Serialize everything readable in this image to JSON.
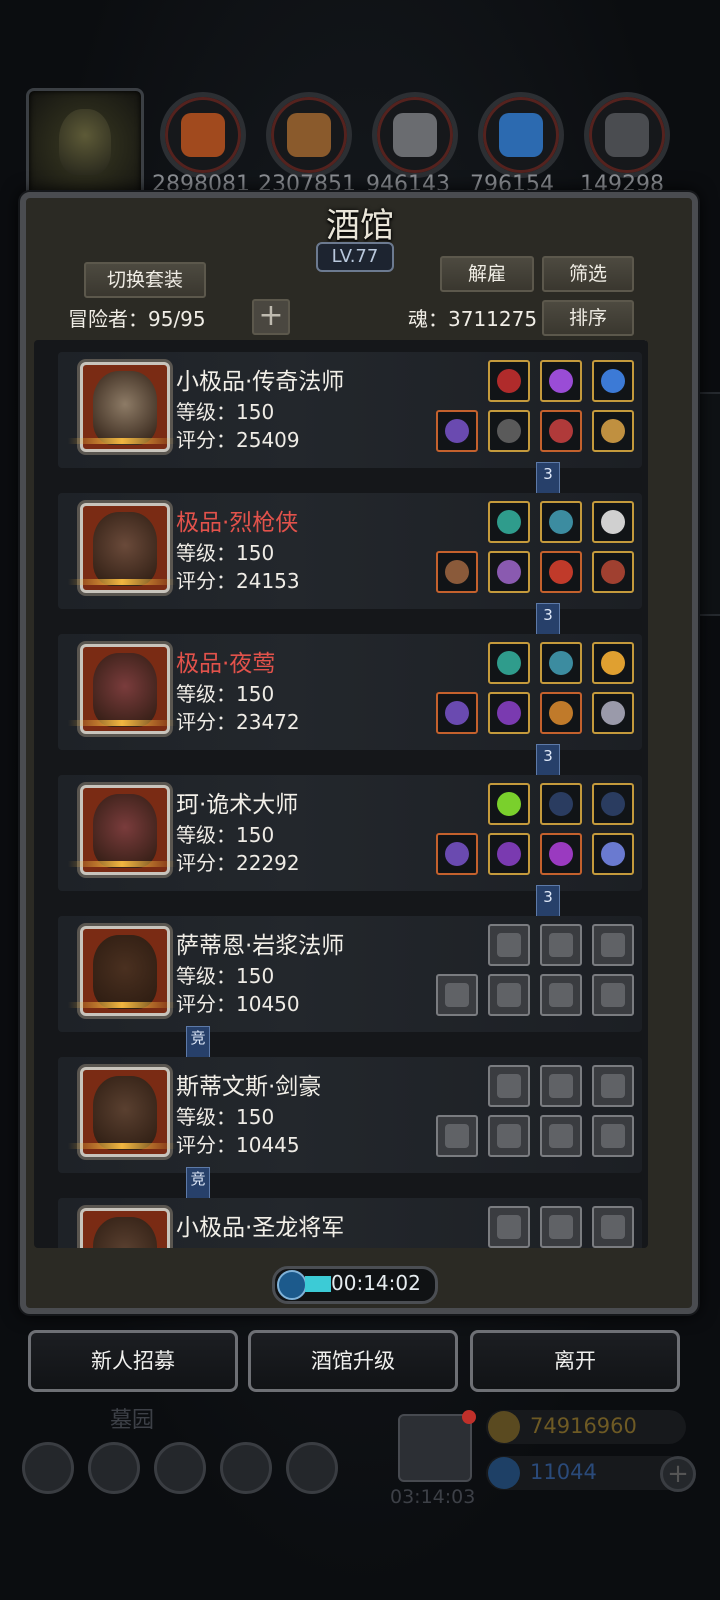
{
  "top": {
    "resources": [
      {
        "value": "2898081",
        "icon": "meat-icon",
        "color": "#a14a1e"
      },
      {
        "value": "2307851",
        "icon": "wood-icon",
        "color": "#8a5a2c"
      },
      {
        "value": "946143",
        "icon": "stone-icon",
        "color": "#6a6c70"
      },
      {
        "value": "796154",
        "icon": "crystal-icon",
        "color": "#2c6ab0"
      },
      {
        "value": "149298",
        "icon": "iron-icon",
        "color": "#4a4c50"
      }
    ]
  },
  "tavern": {
    "title": "酒馆",
    "level": "LV.77",
    "switch_outfit": "切换套装",
    "dismiss": "解雇",
    "filter": "筛选",
    "sort": "排序",
    "adventurer_label": "冒险者：95/95",
    "soul_label": "魂：3711275",
    "plus": "+"
  },
  "heroes": [
    {
      "name": "小极品·传奇法师",
      "rare": false,
      "level": "等级：150",
      "score": "评分：25409",
      "tag": "3",
      "face": "#8d7b66"
    },
    {
      "name": "极品·烈枪侠",
      "rare": true,
      "level": "等级：150",
      "score": "评分：24153",
      "tag": "3",
      "face": "#6a4a3a"
    },
    {
      "name": "极品·夜莺",
      "rare": true,
      "level": "等级：150",
      "score": "评分：23472",
      "tag": "3",
      "face": "#7a3c3c"
    },
    {
      "name": "珂·诡术大师",
      "rare": false,
      "level": "等级：150",
      "score": "评分：22292",
      "tag": "3",
      "face": "#7a3c3c"
    },
    {
      "name": "萨蒂恩·岩浆法师",
      "rare": false,
      "level": "等级：150",
      "score": "评分：10450",
      "tag": "竞",
      "face": "#4a3020"
    },
    {
      "name": "斯蒂文斯·剑豪",
      "rare": false,
      "level": "等级：150",
      "score": "评分：10445",
      "tag": "竞",
      "face": "#5a4030"
    },
    {
      "name": "小极品·圣龙将军",
      "rare": false,
      "level": "",
      "score": "",
      "tag": "",
      "face": "#5a4030"
    }
  ],
  "timer": "00:14:02",
  "buttons": {
    "recruit": "新人招募",
    "upgrade": "酒馆升级",
    "leave": "离开"
  },
  "hud": {
    "cemetery": "墓园",
    "gift_timer": "03:14:03",
    "gold": "74916960",
    "gems": "11044"
  }
}
